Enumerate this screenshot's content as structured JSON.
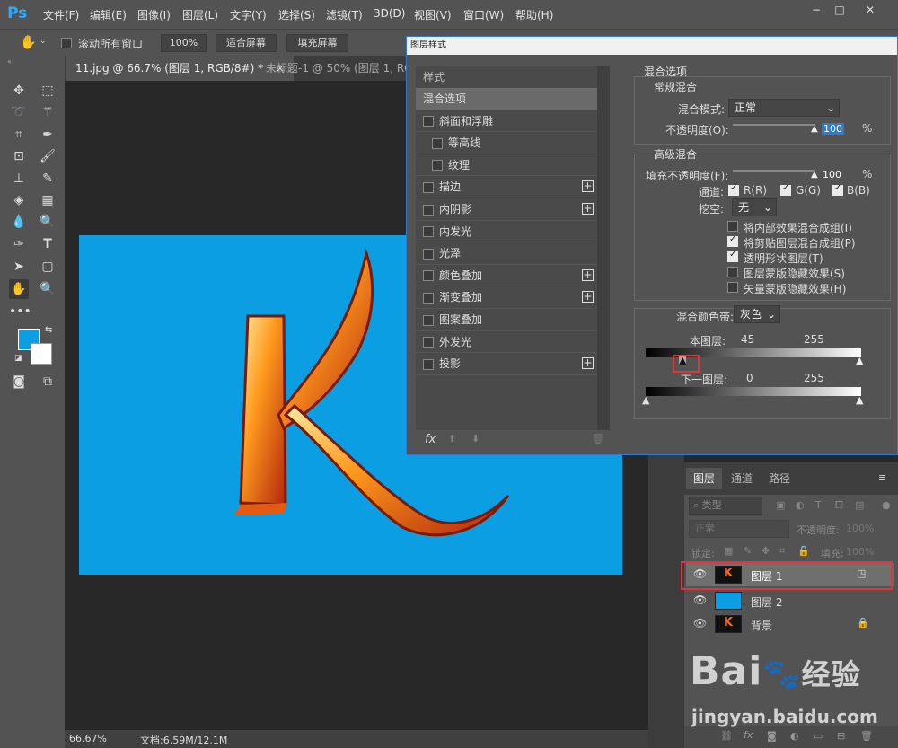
{
  "app": {
    "logo": "Ps"
  },
  "menu": [
    "文件(F)",
    "编辑(E)",
    "图像(I)",
    "图层(L)",
    "文字(Y)",
    "选择(S)",
    "滤镜(T)",
    "3D(D)",
    "视图(V)",
    "窗口(W)",
    "帮助(H)"
  ],
  "options_bar": {
    "scroll_all": "滚动所有窗口",
    "zoom": "100%",
    "fit_screen": "适合屏幕",
    "fill_screen": "填充屏幕"
  },
  "tabs": [
    {
      "label": "11.jpg @ 66.7% (图层 1, RGB/8#) *",
      "close": "×"
    },
    {
      "label": "未标题-1 @ 50% (图层 1, RGB/8#)"
    }
  ],
  "status": {
    "zoom": "66.67%",
    "doc": "文档:6.59M/12.1M"
  },
  "dialog": {
    "title": "图层样式",
    "styles_header": "样式",
    "styles": [
      {
        "label": "混合选项",
        "checkbox": false,
        "plus": false,
        "selected": true
      },
      {
        "label": "斜面和浮雕",
        "checkbox": true,
        "plus": false
      },
      {
        "label": "等高线",
        "checkbox": true,
        "plus": false,
        "indent": true
      },
      {
        "label": "纹理",
        "checkbox": true,
        "plus": false,
        "indent": true
      },
      {
        "label": "描边",
        "checkbox": true,
        "plus": true
      },
      {
        "label": "内阴影",
        "checkbox": true,
        "plus": true
      },
      {
        "label": "内发光",
        "checkbox": true,
        "plus": false
      },
      {
        "label": "光泽",
        "checkbox": true,
        "plus": false
      },
      {
        "label": "颜色叠加",
        "checkbox": true,
        "plus": true
      },
      {
        "label": "渐变叠加",
        "checkbox": true,
        "plus": true
      },
      {
        "label": "图案叠加",
        "checkbox": true,
        "plus": false
      },
      {
        "label": "外发光",
        "checkbox": true,
        "plus": false
      },
      {
        "label": "投影",
        "checkbox": true,
        "plus": true
      }
    ],
    "fx": "fx",
    "blend_options": "混合选项",
    "general_blend": "常规混合",
    "blend_mode_label": "混合模式:",
    "blend_mode_value": "正常",
    "opacity_label": "不透明度(O):",
    "opacity_value": "100",
    "opacity_fraction": 1.0,
    "percent": "%",
    "advanced_blend": "高级混合",
    "fill_opacity_label": "填充不透明度(F):",
    "fill_opacity_value": "100",
    "fill_opacity_fraction": 1.0,
    "channels_label": "通道:",
    "channel_r": "R(R)",
    "channel_g": "G(G)",
    "channel_b": "B(B)",
    "knockout_label": "挖空:",
    "knockout_value": "无",
    "options": [
      {
        "label": "将内部效果混合成组(I)",
        "checked": false
      },
      {
        "label": "将剪贴图层混合成组(P)",
        "checked": true
      },
      {
        "label": "透明形状图层(T)",
        "checked": true
      },
      {
        "label": "图层蒙版隐藏效果(S)",
        "checked": false
      },
      {
        "label": "矢量蒙版隐藏效果(H)",
        "checked": false
      }
    ],
    "blend_if_label": "混合颜色带:",
    "blend_if_value": "灰色",
    "this_layer_label": "本图层:",
    "this_layer_low": "45",
    "this_layer_high": "255",
    "underlying_label": "下一图层:",
    "underlying_low": "0",
    "underlying_high": "255"
  },
  "layers_panel": {
    "tabs": [
      "图层",
      "通道",
      "路径"
    ],
    "kind_label": "类型",
    "blend_mode": "正常",
    "opacity_label": "不透明度:",
    "opacity_value": "100%",
    "lock_label": "锁定:",
    "fill_label": "填充:",
    "fill_value": "100%",
    "layers": [
      {
        "name": "图层 1",
        "selected": true
      },
      {
        "name": "图层 2",
        "selected": false
      },
      {
        "name": "背景",
        "selected": false,
        "locked": true
      }
    ]
  },
  "watermark": {
    "brand": "Bai",
    "brand2": "经验",
    "url": "jingyan.baidu.com"
  },
  "colors": {
    "accent": "#31a8ff",
    "canvas_blue": "#0b9ee3",
    "highlight": "#e0343a",
    "panel": "#535353"
  }
}
